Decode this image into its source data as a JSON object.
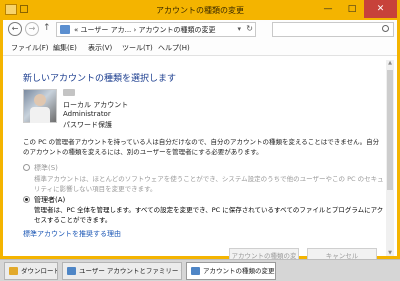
{
  "window": {
    "title": "アカウントの種類の変更",
    "controls": {
      "minimize": "—",
      "maximize": "□",
      "close": "✕"
    }
  },
  "nav": {
    "back": "←",
    "forward": "→",
    "up": "↑",
    "address": "«  ユーザー アカ...  ›  アカウントの種類の変更",
    "dropdown": "▾",
    "refresh": "↻",
    "search_placeholder": ""
  },
  "menu": [
    "ファイル(F)",
    "編集(E)",
    "表示(V)",
    "ツール(T)",
    "ヘルプ(H)"
  ],
  "content": {
    "heading": "新しいアカウントの種類を選択します",
    "account": {
      "type": "ローカル アカウント",
      "group": "Administrator",
      "protection": "パスワード保護"
    },
    "description": "この PC の管理者アカウントを持っている人は自分だけなので、自分のアカウントの種類を変えることはできません。自分のアカウントの種類を変えるには、別のユーザーを管理者にする必要があります。",
    "options": [
      {
        "label": "標準(S)",
        "description": "標準アカウントは、ほとんどのソフトウェアを使うことができ、システム設定のうちで他のユーザーやこの PC のセキュリティに影響しない項目を変更できます。",
        "selected": false,
        "enabled": false
      },
      {
        "label": "管理者(A)",
        "description": "管理者は、PC 全体を管理します。すべての設定を変更でき、PC に保存されているすべてのファイルとプログラムにアクセスすることができます。",
        "selected": true,
        "enabled": true
      }
    ],
    "recommend_link": "標準アカウントを推奨する理由",
    "change_button": "アカウントの種類の変更",
    "cancel_button": "キャンセル"
  },
  "scrollbar": {
    "up": "▲",
    "down": "▼"
  },
  "taskbar": {
    "items": [
      {
        "label": "ダウンロード",
        "active": false,
        "icon_color": "#e2a92b"
      },
      {
        "label": "ユーザー アカウントとファミリー セーフティ",
        "active": false,
        "icon_color": "#4f86c6"
      },
      {
        "label": "アカウントの種類の変更",
        "active": true,
        "icon_color": "#4f86c6"
      }
    ]
  },
  "colors": {
    "titlebar": "#f4b400",
    "close": "#c7423a",
    "heading": "#1b3d8f",
    "link": "#1a56b5"
  }
}
